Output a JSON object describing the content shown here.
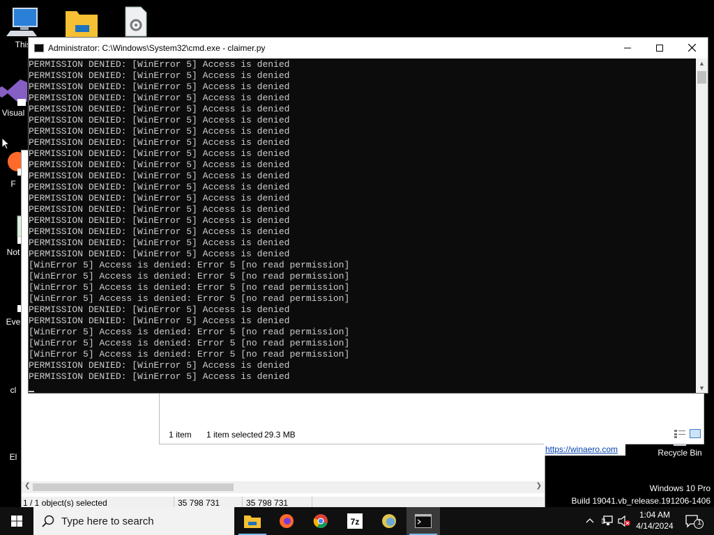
{
  "desktop": {
    "icons": [
      {
        "label": "This"
      },
      {
        "label": "Visual"
      },
      {
        "label": "F"
      },
      {
        "label": "Not"
      },
      {
        "label": "Eve"
      },
      {
        "label": "cl"
      },
      {
        "label": "El"
      }
    ],
    "recycle_bin": "Recycle Bin",
    "winaero_link": "https://winaero.com",
    "windows_edition": "Windows 10 Pro",
    "build": "Build 19041.vb_release.191206-1406"
  },
  "explorer_bg": {
    "status_items": "1 item",
    "status_selected": "1 item selected",
    "status_size": "29.3 MB"
  },
  "explorer_bg2": {
    "status_selected": "1 / 1 object(s) selected",
    "status_size1": "35 798 731",
    "status_size2": "35 798 731"
  },
  "cmd": {
    "title": "Administrator: C:\\Windows\\System32\\cmd.exe - claimer.py",
    "lines": [
      "PERMISSION DENIED: [WinError 5] Access is denied",
      "PERMISSION DENIED: [WinError 5] Access is denied",
      "PERMISSION DENIED: [WinError 5] Access is denied",
      "PERMISSION DENIED: [WinError 5] Access is denied",
      "PERMISSION DENIED: [WinError 5] Access is denied",
      "PERMISSION DENIED: [WinError 5] Access is denied",
      "PERMISSION DENIED: [WinError 5] Access is denied",
      "PERMISSION DENIED: [WinError 5] Access is denied",
      "PERMISSION DENIED: [WinError 5] Access is denied",
      "PERMISSION DENIED: [WinError 5] Access is denied",
      "PERMISSION DENIED: [WinError 5] Access is denied",
      "PERMISSION DENIED: [WinError 5] Access is denied",
      "PERMISSION DENIED: [WinError 5] Access is denied",
      "PERMISSION DENIED: [WinError 5] Access is denied",
      "PERMISSION DENIED: [WinError 5] Access is denied",
      "PERMISSION DENIED: [WinError 5] Access is denied",
      "PERMISSION DENIED: [WinError 5] Access is denied",
      "PERMISSION DENIED: [WinError 5] Access is denied",
      "[WinError 5] Access is denied: Error 5 [no read permission]",
      "[WinError 5] Access is denied: Error 5 [no read permission]",
      "[WinError 5] Access is denied: Error 5 [no read permission]",
      "[WinError 5] Access is denied: Error 5 [no read permission]",
      "PERMISSION DENIED: [WinError 5] Access is denied",
      "PERMISSION DENIED: [WinError 5] Access is denied",
      "[WinError 5] Access is denied: Error 5 [no read permission]",
      "[WinError 5] Access is denied: Error 5 [no read permission]",
      "[WinError 5] Access is denied: Error 5 [no read permission]",
      "PERMISSION DENIED: [WinError 5] Access is denied",
      "PERMISSION DENIED: [WinError 5] Access is denied"
    ]
  },
  "taskbar": {
    "search_placeholder": "Type here to search",
    "time": "1:04 AM",
    "date": "4/14/2024",
    "notification_count": "1",
    "apps": [
      "file-explorer",
      "firefox",
      "chrome",
      "7zip",
      "unknown-app",
      "cmd"
    ]
  },
  "colors": {
    "console_bg": "#0c0c0c",
    "console_text": "#cccccc",
    "taskbar_bg": "#101010",
    "active_indicator": "#76b9ed"
  }
}
